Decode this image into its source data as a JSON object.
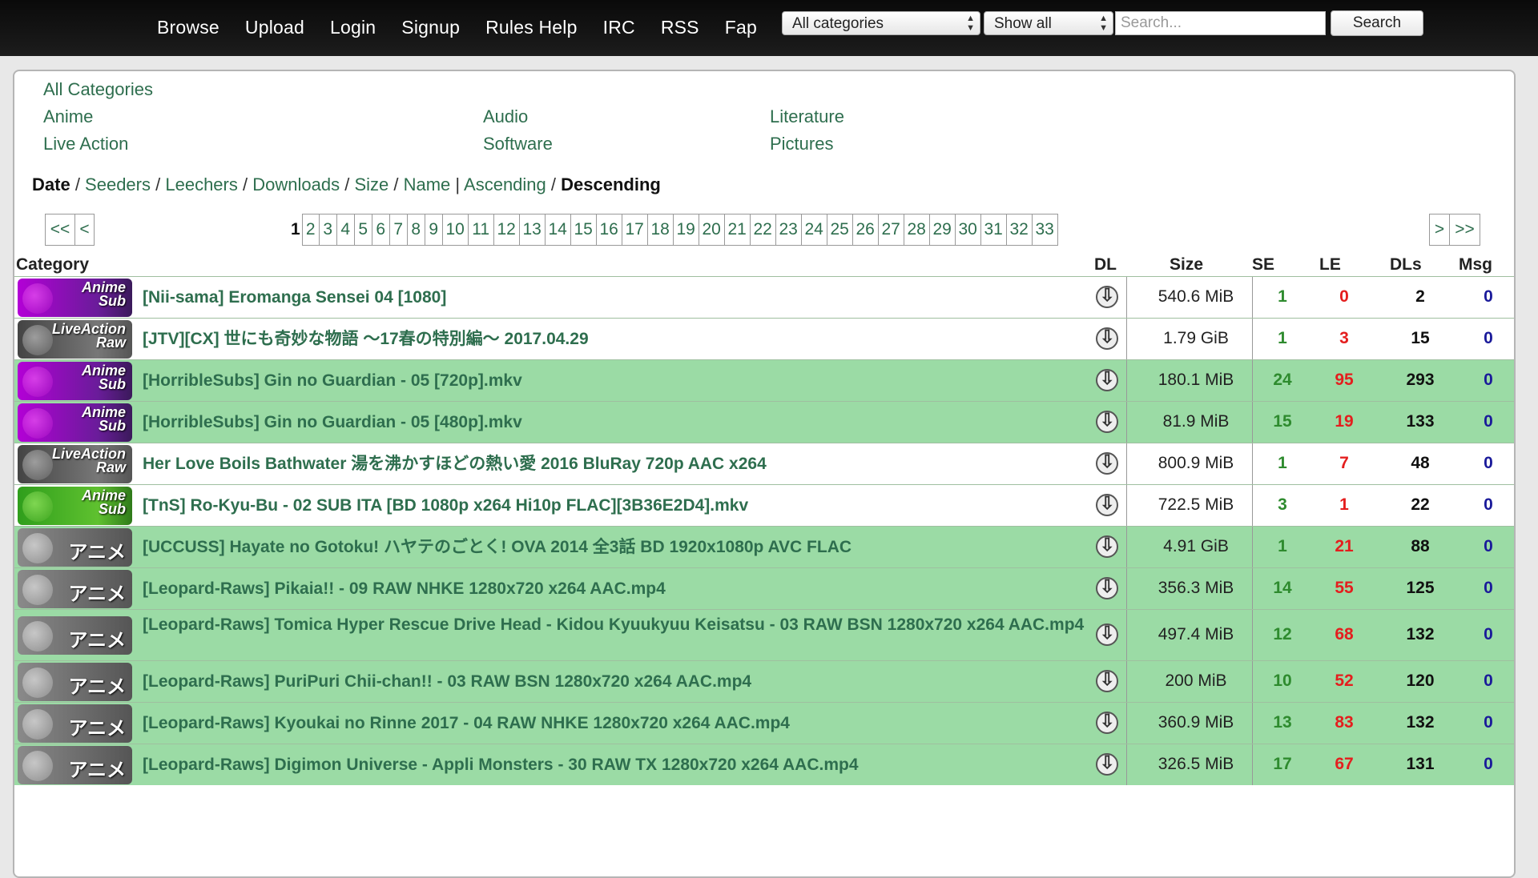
{
  "nav": [
    "Browse",
    "Upload",
    "Login",
    "Signup",
    "Rules Help",
    "IRC",
    "RSS",
    "Fap"
  ],
  "search": {
    "category_value": "All categories",
    "filter_value": "Show all",
    "placeholder": "Search...",
    "button": "Search"
  },
  "categories": {
    "all": "All Categories",
    "col1": [
      "Anime",
      "Live Action"
    ],
    "col2": [
      "Audio",
      "Software"
    ],
    "col3": [
      "Literature",
      "Pictures"
    ]
  },
  "sort": {
    "date": "Date",
    "seeders": "Seeders",
    "leechers": "Leechers",
    "downloads": "Downloads",
    "size": "Size",
    "name": "Name",
    "ascending": "Ascending",
    "descending": "Descending"
  },
  "pagination": {
    "first": "<<",
    "prev": "<",
    "current": "1",
    "pages": [
      "2",
      "3",
      "4",
      "5",
      "6",
      "7",
      "8",
      "9",
      "10",
      "11",
      "12",
      "13",
      "14",
      "15",
      "16",
      "17",
      "18",
      "19",
      "20",
      "21",
      "22",
      "23",
      "24",
      "25",
      "26",
      "27",
      "28",
      "29",
      "30",
      "31",
      "32",
      "33"
    ],
    "next": ">",
    "last": ">>"
  },
  "headers": {
    "category": "Category",
    "dl": "DL",
    "size": "Size",
    "se": "SE",
    "le": "LE",
    "dls": "DLs",
    "msg": "Msg"
  },
  "torrents": [
    {
      "badge": "anime-sub",
      "badge_l1": "Anime",
      "badge_l2": "Sub",
      "title": "[Nii-sama] Eromanga Sensei 04 [1080]",
      "size": "540.6 MiB",
      "se": "1",
      "le": "0",
      "dls": "2",
      "msg": "0",
      "trusted": false,
      "tall": false
    },
    {
      "badge": "live-raw",
      "badge_l1": "LiveAction",
      "badge_l2": "Raw",
      "title": "[JTV][CX] 世にも奇妙な物語 ～17春の特別編～ 2017.04.29",
      "size": "1.79 GiB",
      "se": "1",
      "le": "3",
      "dls": "15",
      "msg": "0",
      "trusted": false,
      "tall": false
    },
    {
      "badge": "anime-sub",
      "badge_l1": "Anime",
      "badge_l2": "Sub",
      "title": "[HorribleSubs] Gin no Guardian - 05 [720p].mkv",
      "size": "180.1 MiB",
      "se": "24",
      "le": "95",
      "dls": "293",
      "msg": "0",
      "trusted": true,
      "tall": false
    },
    {
      "badge": "anime-sub",
      "badge_l1": "Anime",
      "badge_l2": "Sub",
      "title": "[HorribleSubs] Gin no Guardian - 05 [480p].mkv",
      "size": "81.9 MiB",
      "se": "15",
      "le": "19",
      "dls": "133",
      "msg": "0",
      "trusted": true,
      "tall": false
    },
    {
      "badge": "live-raw",
      "badge_l1": "LiveAction",
      "badge_l2": "Raw",
      "title": "Her Love Boils Bathwater 湯を沸かすほどの熱い愛 2016 BluRay 720p AAC x264",
      "size": "800.9 MiB",
      "se": "1",
      "le": "7",
      "dls": "48",
      "msg": "0",
      "trusted": false,
      "tall": false
    },
    {
      "badge": "anime-sub-green",
      "badge_l1": "Anime",
      "badge_l2": "Sub",
      "title": "[TnS] Ro-Kyu-Bu - 02 SUB ITA [BD 1080p x264 Hi10p FLAC][3B36E2D4].mkv",
      "size": "722.5 MiB",
      "se": "3",
      "le": "1",
      "dls": "22",
      "msg": "0",
      "trusted": false,
      "tall": false
    },
    {
      "badge": "anime-raw",
      "badge_l1": "アニメ",
      "badge_l2": "",
      "title": "[UCCUSS] Hayate no Gotoku! ハヤテのごとく! OVA 2014 全3話 BD 1920x1080p AVC FLAC",
      "size": "4.91 GiB",
      "se": "1",
      "le": "21",
      "dls": "88",
      "msg": "0",
      "trusted": true,
      "tall": false
    },
    {
      "badge": "anime-raw",
      "badge_l1": "アニメ",
      "badge_l2": "",
      "title": "[Leopard-Raws] Pikaia!! - 09 RAW NHKE 1280x720 x264 AAC.mp4",
      "size": "356.3 MiB",
      "se": "14",
      "le": "55",
      "dls": "125",
      "msg": "0",
      "trusted": true,
      "tall": false
    },
    {
      "badge": "anime-raw",
      "badge_l1": "アニメ",
      "badge_l2": "",
      "title": "[Leopard-Raws] Tomica Hyper Rescue Drive Head - Kidou Kyuukyuu Keisatsu - 03 RAW BSN 1280x720 x264 AAC.mp4",
      "size": "497.4 MiB",
      "se": "12",
      "le": "68",
      "dls": "132",
      "msg": "0",
      "trusted": true,
      "tall": true
    },
    {
      "badge": "anime-raw",
      "badge_l1": "アニメ",
      "badge_l2": "",
      "title": "[Leopard-Raws] PuriPuri Chii-chan!! - 03 RAW BSN 1280x720 x264 AAC.mp4",
      "size": "200 MiB",
      "se": "10",
      "le": "52",
      "dls": "120",
      "msg": "0",
      "trusted": true,
      "tall": false
    },
    {
      "badge": "anime-raw",
      "badge_l1": "アニメ",
      "badge_l2": "",
      "title": "[Leopard-Raws] Kyoukai no Rinne 2017 - 04 RAW NHKE 1280x720 x264 AAC.mp4",
      "size": "360.9 MiB",
      "se": "13",
      "le": "83",
      "dls": "132",
      "msg": "0",
      "trusted": true,
      "tall": false
    },
    {
      "badge": "anime-raw",
      "badge_l1": "アニメ",
      "badge_l2": "",
      "title": "[Leopard-Raws] Digimon Universe - Appli Monsters - 30 RAW TX 1280x720 x264 AAC.mp4",
      "size": "326.5 MiB",
      "se": "17",
      "le": "67",
      "dls": "131",
      "msg": "0",
      "trusted": true,
      "tall": false
    }
  ]
}
